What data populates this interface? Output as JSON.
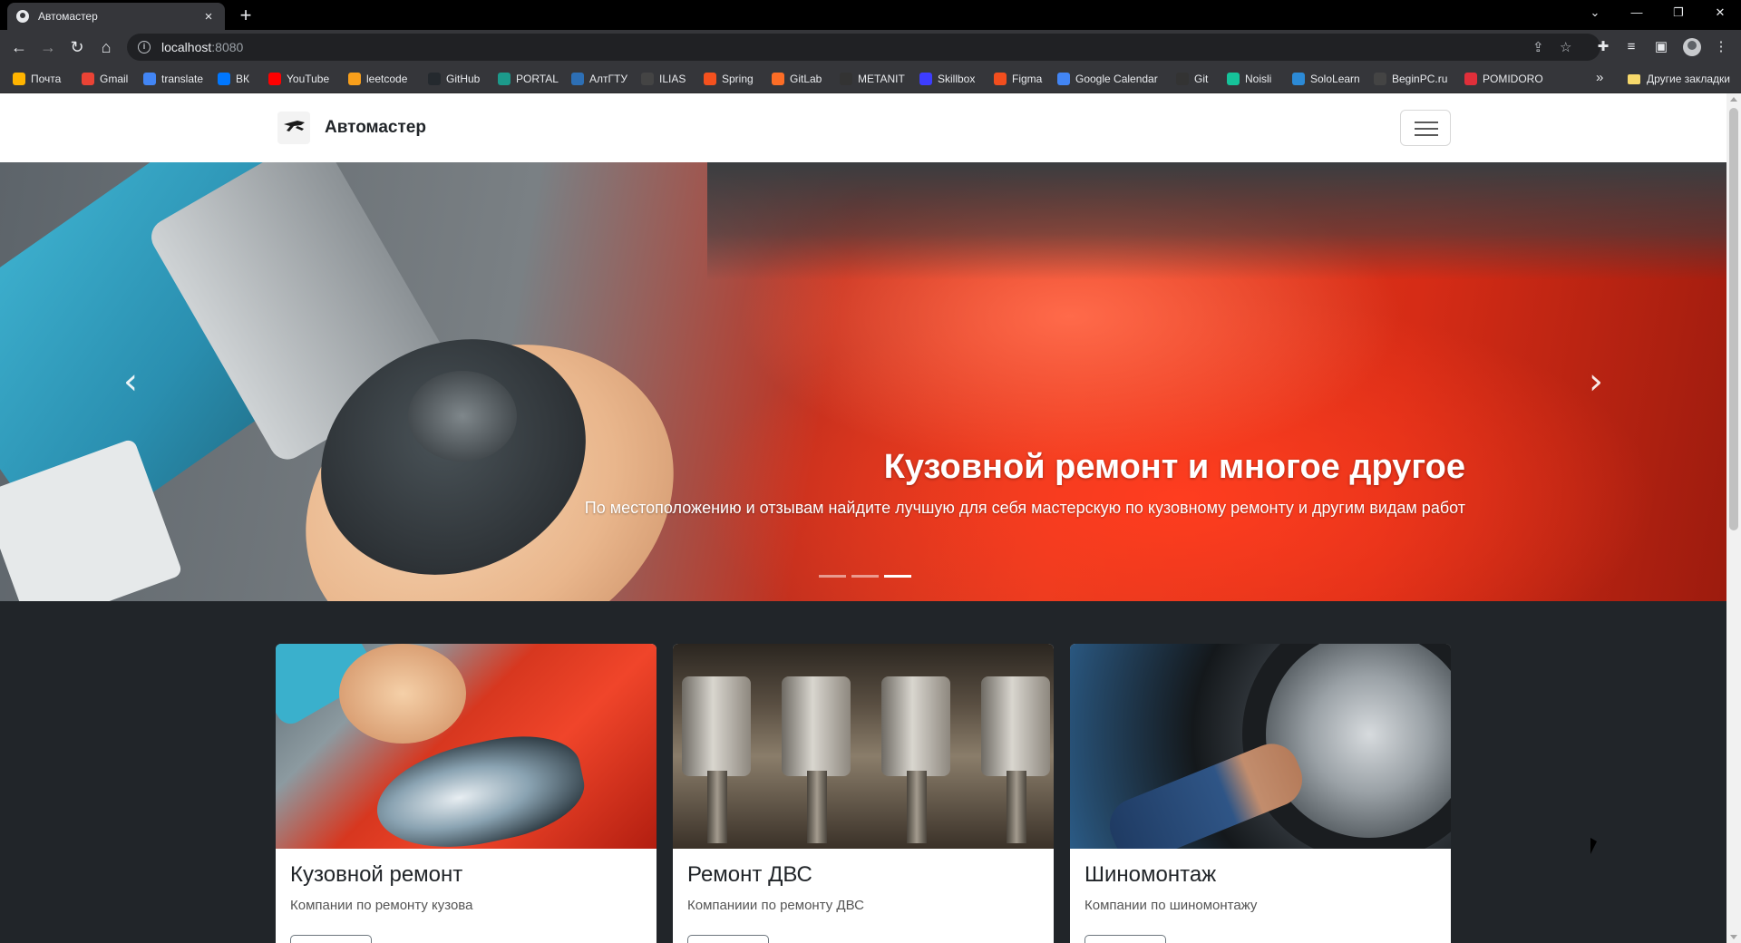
{
  "browser": {
    "tab_title": "Автомастер",
    "tab_close": "×",
    "new_tab": "+",
    "url_host": "localhost",
    "url_port": ":8080",
    "window_controls": {
      "tabsearch": "⌄",
      "minimize": "—",
      "restore": "❐",
      "close": "✕"
    }
  },
  "bookmarks": [
    {
      "label": "Почта",
      "icon": "mail-icon",
      "color": "#ffb400"
    },
    {
      "label": "Gmail",
      "icon": "gmail-icon",
      "color": "#ea4335"
    },
    {
      "label": "translate",
      "icon": "translate-icon",
      "color": "#4285f4"
    },
    {
      "label": "ВК",
      "icon": "vk-icon",
      "color": "#0077ff"
    },
    {
      "label": "YouTube",
      "icon": "youtube-icon",
      "color": "#ff0000"
    },
    {
      "label": "leetcode",
      "icon": "leetcode-icon",
      "color": "#f89f1b"
    },
    {
      "label": "GitHub",
      "icon": "github-icon",
      "color": "#24292e"
    },
    {
      "label": "PORTAL",
      "icon": "portal-icon",
      "color": "#1c9a8b"
    },
    {
      "label": "АлтГТУ",
      "icon": "altgtu-icon",
      "color": "#2d6fb5"
    },
    {
      "label": "ILIAS",
      "icon": "ilias-icon",
      "color": "#444"
    },
    {
      "label": "Spring",
      "icon": "spring-icon",
      "color": "#f4511e"
    },
    {
      "label": "GitLab",
      "icon": "gitlab-icon",
      "color": "#fc6d26"
    },
    {
      "label": "METANIT",
      "icon": "metanit-icon",
      "color": "#333"
    },
    {
      "label": "Skillbox",
      "icon": "skillbox-icon",
      "color": "#3d3dff"
    },
    {
      "label": "Figma",
      "icon": "figma-icon",
      "color": "#f24e1e"
    },
    {
      "label": "Google Calendar",
      "icon": "google-icon",
      "color": "#4285f4"
    },
    {
      "label": "Git",
      "icon": "git-icon",
      "color": "#333"
    },
    {
      "label": "Noisli",
      "icon": "noisli-icon",
      "color": "#16c39a"
    },
    {
      "label": "SoloLearn",
      "icon": "sololearn-icon",
      "color": "#2c8ad6"
    },
    {
      "label": "BeginPC.ru",
      "icon": "beginpc-icon",
      "color": "#444"
    },
    {
      "label": "POMIDORO",
      "icon": "pomidoro-icon",
      "color": "#e02f3a"
    }
  ],
  "bookmarks_more": "»",
  "other_bookmarks": "Другие закладки",
  "site": {
    "brand": "Автомастер",
    "carousel": {
      "heading": "Кузовной ремонт и многое другое",
      "text": "По местоположению и отзывам найдите лучшую для себя мастерскую по кузовному ремонту и другим видам работ",
      "prev": "‹",
      "next": "›",
      "active_slide": 3,
      "slides_count": 3
    },
    "cards": [
      {
        "title": "Кузовной ремонт",
        "text": "Компании по ремонту кузова"
      },
      {
        "title": "Ремонт ДВС",
        "text": "Компаниии по ремонту ДВС"
      },
      {
        "title": "Шиномонтаж",
        "text": "Компании по шиномонтажу"
      }
    ]
  }
}
